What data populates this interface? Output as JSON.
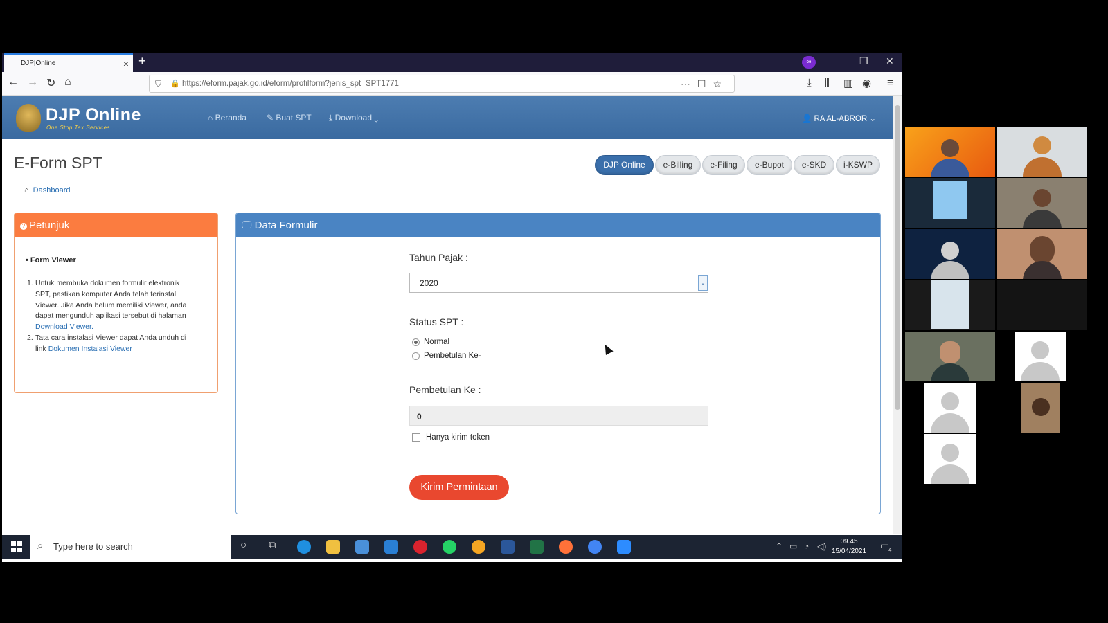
{
  "browser": {
    "tab_title": "DJP|Online",
    "url": "https://eform.pajak.go.id/eform/profilform?jenis_spt=SPT1771"
  },
  "site": {
    "brand": "DJP Online",
    "tagline": "One Stop Tax Services",
    "menu": [
      "Beranda",
      "Buat SPT",
      "Download"
    ],
    "user": "RA AL-ABROR"
  },
  "page": {
    "title": "E-Form SPT",
    "breadcrumb": "Dashboard",
    "pills": [
      "DJP Online",
      "e-Billing",
      "e-Filing",
      "e-Bupot",
      "e-SKD",
      "i-KSWP"
    ],
    "active_pill": "DJP Online"
  },
  "petunjuk": {
    "title": "Petunjuk",
    "section": "Form Viewer",
    "item1_text": "Untuk membuka dokumen formulir elektronik SPT, pastikan komputer Anda telah terinstal Viewer. Jika Anda belum memiliki Viewer, anda dapat mengunduh aplikasi tersebut di halaman",
    "item1_link": "Download Viewer.",
    "item2_text": "Tata cara instalasi Viewer dapat Anda unduh di link",
    "item2_link": "Dokumen Instalasi Viewer"
  },
  "form": {
    "title": "Data Formulir",
    "tahun_label": "Tahun Pajak :",
    "tahun_value": "2020",
    "status_label": "Status SPT :",
    "status_options": [
      "Normal",
      "Pembetulan Ke-"
    ],
    "status_selected": "Normal",
    "pembetulan_label": "Pembetulan Ke :",
    "pembetulan_value": "0",
    "token_label": "Hanya kirim token",
    "token_checked": false,
    "submit_label": "Kirim Permintaan"
  },
  "taskbar": {
    "search_placeholder": "Type here to search",
    "time": "09.45",
    "date": "15/04/2021",
    "notification_count": "4"
  },
  "colors": {
    "header_blue": "#3a6aa0",
    "petunjuk_orange": "#fb7c40",
    "form_blue": "#4a84c3",
    "submit_red": "#e9482f"
  }
}
